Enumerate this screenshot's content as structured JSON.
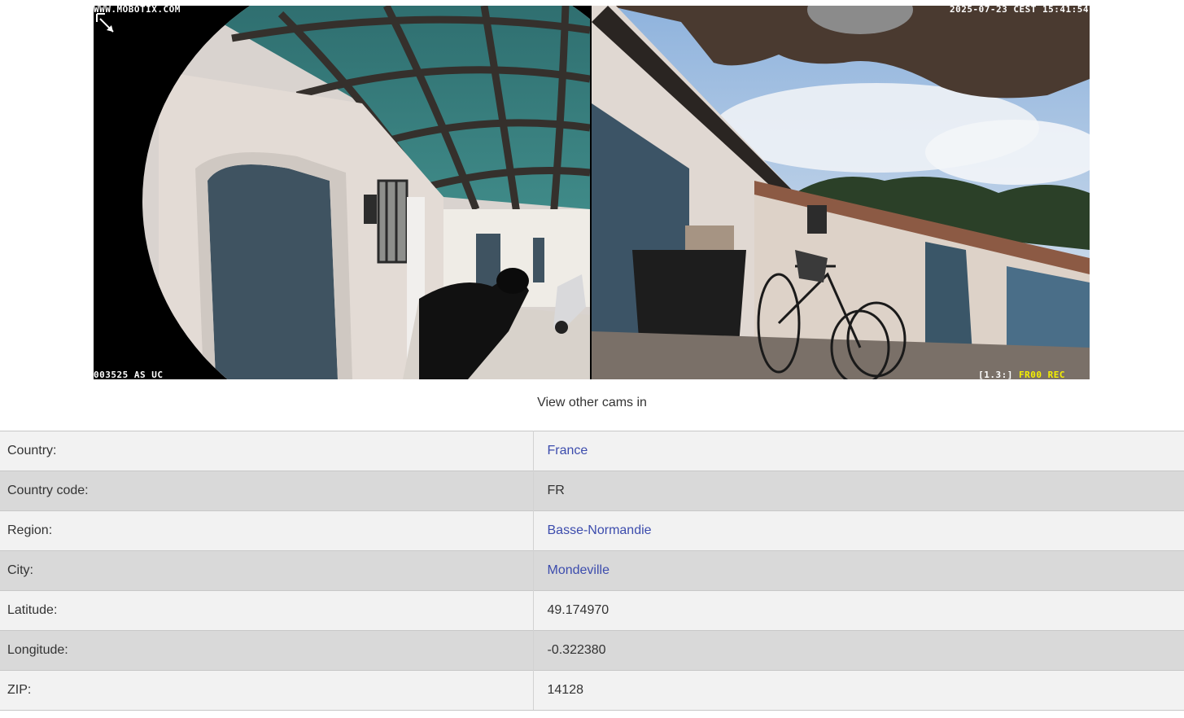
{
  "camera": {
    "overlay_top_left": "WWW.MOBOTIX.COM",
    "overlay_top_right": "2025-07-23 CEST 15:41:54",
    "overlay_bottom_left": "003525 AS UC",
    "overlay_bottom_right_prefix": "[1.3:]",
    "overlay_bottom_right_rec": "FR00 REC",
    "left_view_description": "fisheye view of pergola-covered entrance with door and motorcycles",
    "right_view_description": "fisheye view of courtyard wall with bicycles and sky"
  },
  "caption": "View other cams in",
  "info_table": {
    "rows": [
      {
        "label": "Country:",
        "value": "France",
        "link": true
      },
      {
        "label": "Country code:",
        "value": "FR",
        "link": false
      },
      {
        "label": "Region:",
        "value": "Basse-Normandie",
        "link": true
      },
      {
        "label": "City:",
        "value": "Mondeville",
        "link": true
      },
      {
        "label": "Latitude:",
        "value": "49.174970",
        "link": false
      },
      {
        "label": "Longitude:",
        "value": "-0.322380",
        "link": false
      },
      {
        "label": "ZIP:",
        "value": "14128",
        "link": false
      }
    ]
  },
  "colors": {
    "link": "#3c4cad",
    "row_odd": "#f2f2f2",
    "row_even": "#d9d9d9",
    "overlay_rec": "#f5f000"
  }
}
